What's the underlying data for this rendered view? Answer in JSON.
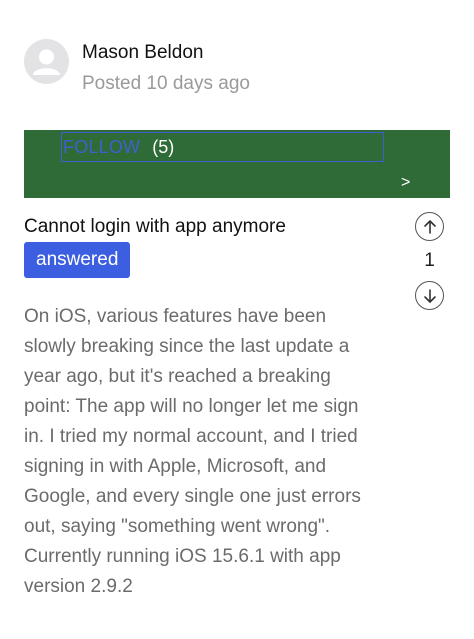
{
  "author": {
    "name": "Mason Beldon",
    "posted": "Posted 10 days ago",
    "avatar_icon": "user-avatar-icon"
  },
  "follow": {
    "label": "FOLLOW",
    "count": "(5)",
    "chevron": ">",
    "banner_color": "#2f6b37"
  },
  "question": {
    "title": "Cannot login with app anymore",
    "status": "answered",
    "status_color": "#3b5fe0"
  },
  "votes": {
    "count": "1",
    "up_icon": "arrow-up-circle-icon",
    "down_icon": "arrow-down-circle-icon"
  },
  "body": {
    "lines": [
      "On iOS, various features have been",
      "slowly breaking since the last update a",
      "year ago, but it's reached a breaking",
      "point: The app will no longer let me sign",
      "in. I tried my normal account, and I tried",
      "signing in with Apple, Microsoft, and",
      "Google, and every single one just errors",
      "out, saying \"something went wrong\".",
      "Currently running iOS 15.6.1 with app",
      "version 2.9.2"
    ]
  }
}
